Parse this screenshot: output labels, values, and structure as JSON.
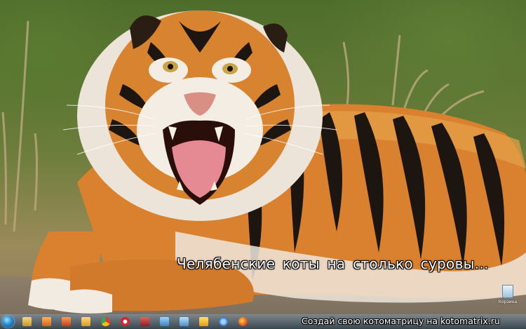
{
  "meme": {
    "caption": "Челябенские  коты  на  столько  суровы..."
  },
  "desktop": {
    "recycle_bin_label": "Корзина",
    "wallpaper_subject": "tiger-roaring"
  },
  "taskbar": {
    "icons": [
      "start-orb",
      "explorer-icon",
      "media-player-icon",
      "photoshop-icon",
      "folder-icon",
      "chrome-icon",
      "opera-icon",
      "app-icon",
      "notepad-icon",
      "network-icon",
      "flash-icon",
      "ie-icon",
      "firefox-icon"
    ]
  },
  "watermark": {
    "text": "Создай свою котоматрицу на kotomatrix.ru"
  },
  "colors": {
    "caption_text": "#ffffff",
    "caption_outline": "#000000",
    "taskbar": "#3a5670"
  }
}
